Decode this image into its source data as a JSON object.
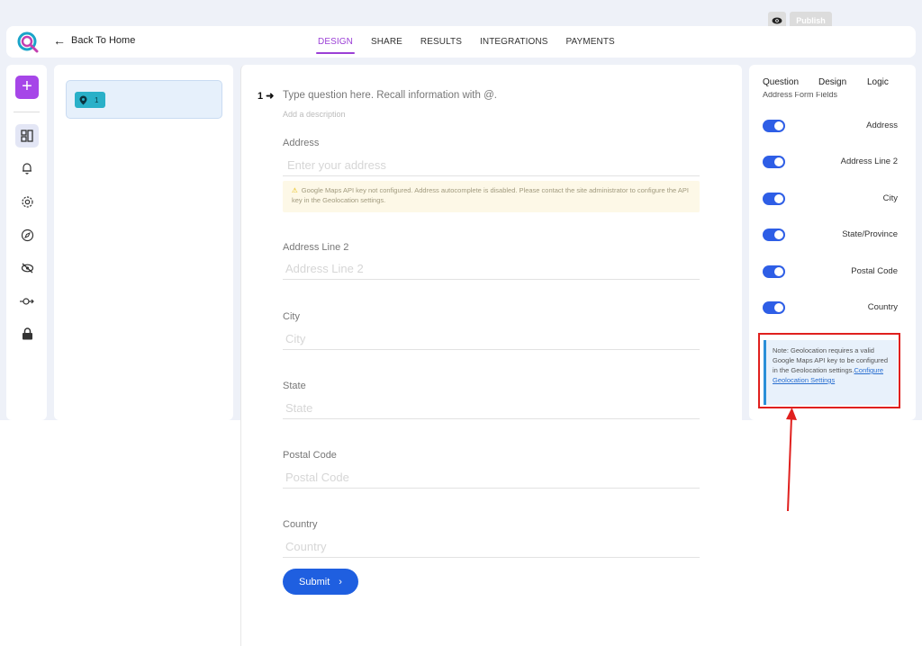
{
  "top": {
    "back_label": "Back To Home",
    "tabs": [
      {
        "label": "DESIGN",
        "active": true
      },
      {
        "label": "SHARE",
        "active": false
      },
      {
        "label": "RESULTS",
        "active": false
      },
      {
        "label": "INTEGRATIONS",
        "active": false
      },
      {
        "label": "PAYMENTS",
        "active": false
      }
    ],
    "publish_label": "Publish"
  },
  "rail": {
    "icons": [
      "add-icon",
      "layout-icon",
      "bell-icon",
      "gear-icon",
      "compass-icon",
      "eye-off-icon",
      "key-icon",
      "lock-icon"
    ]
  },
  "question_list": {
    "items": [
      {
        "number": "1",
        "icon": "location-pin-icon"
      }
    ]
  },
  "editor": {
    "question_number": "1",
    "question_title": "Type question here. Recall information with @.",
    "description_placeholder": "Add a description",
    "fields": [
      {
        "label": "Address",
        "placeholder": "Enter your address"
      },
      {
        "label": "Address Line 2",
        "placeholder": "Address Line 2"
      },
      {
        "label": "City",
        "placeholder": "City"
      },
      {
        "label": "State",
        "placeholder": "State"
      },
      {
        "label": "Postal Code",
        "placeholder": "Postal Code"
      },
      {
        "label": "Country",
        "placeholder": "Country"
      }
    ],
    "warning": "Google Maps API key not configured. Address autocomplete is disabled. Please contact the site administrator to configure the API key in the Geolocation settings.",
    "submit_label": "Submit"
  },
  "right_panel": {
    "tabs": [
      "Question",
      "Design",
      "Logic"
    ],
    "section_header": "Address Form Fields",
    "toggles": [
      {
        "label": "Address",
        "on": true
      },
      {
        "label": "Address Line 2",
        "on": true
      },
      {
        "label": "City",
        "on": true
      },
      {
        "label": "State/Province",
        "on": true
      },
      {
        "label": "Postal Code",
        "on": true
      },
      {
        "label": "Country",
        "on": true
      }
    ],
    "note_text": "Note: Geolocation requires a valid Google Maps API key to be configured in the Geolocation settings.",
    "note_link": "Configure Geolocation Settings"
  },
  "colors": {
    "accent": "#9b3fd6",
    "primary": "#1f5fe0",
    "toggle": "#2e5ee6",
    "highlight": "#e0201e"
  }
}
